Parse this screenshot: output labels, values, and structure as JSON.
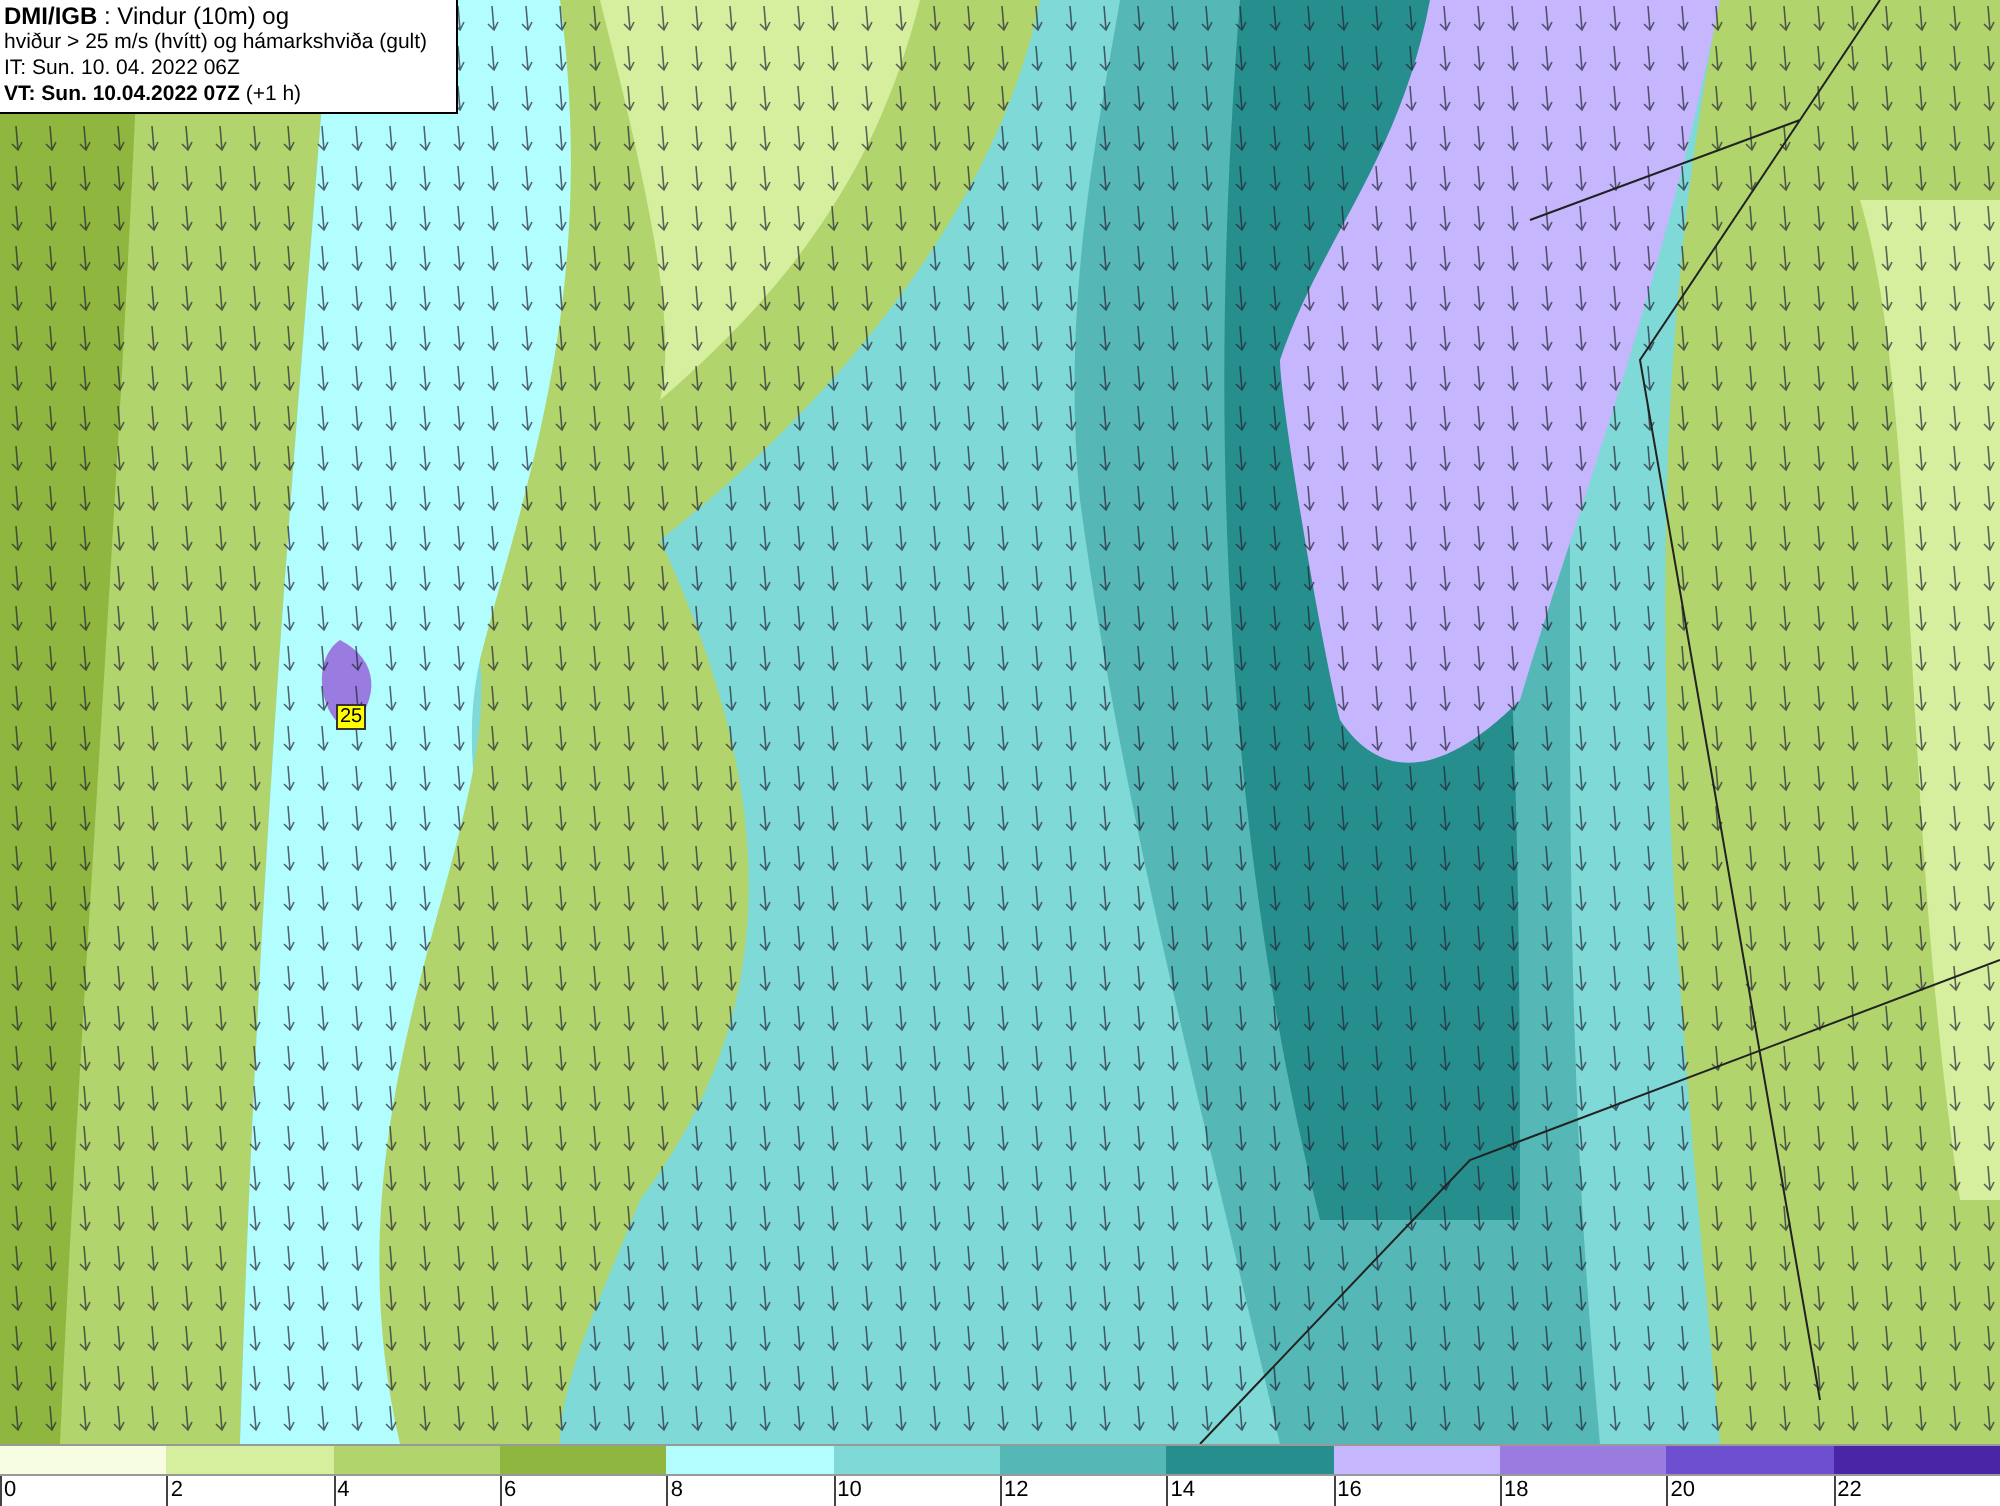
{
  "header": {
    "lines": [
      "**DMI/IGB** : Vindur (10m) og",
      "hviður > 25 m/s (hvítt) og hámarkshviða (gult)",
      "IT: Sun. 10. 04. 2022 06Z",
      "**VT: Sun. 10.04.2022 07Z** (+1 h)"
    ]
  },
  "map": {
    "gust_label": "25"
  },
  "legend": {
    "swatches": [
      {
        "color": "#f7fde0"
      },
      {
        "color": "#d6ef9e"
      },
      {
        "color": "#b1d46c"
      },
      {
        "color": "#8fb63f"
      },
      {
        "color": "#b2fefe"
      },
      {
        "color": "#7fd9d6"
      },
      {
        "color": "#55b8b6"
      },
      {
        "color": "#268f8d"
      },
      {
        "color": "#c6b6fe"
      },
      {
        "color": "#9a7ce0"
      },
      {
        "color": "#6e4fd0"
      },
      {
        "color": "#4a25a6"
      }
    ],
    "ticks": [
      "0",
      "2",
      "4",
      "6",
      "8",
      "10",
      "12",
      "14",
      "16",
      "18",
      "20",
      "22"
    ]
  }
}
